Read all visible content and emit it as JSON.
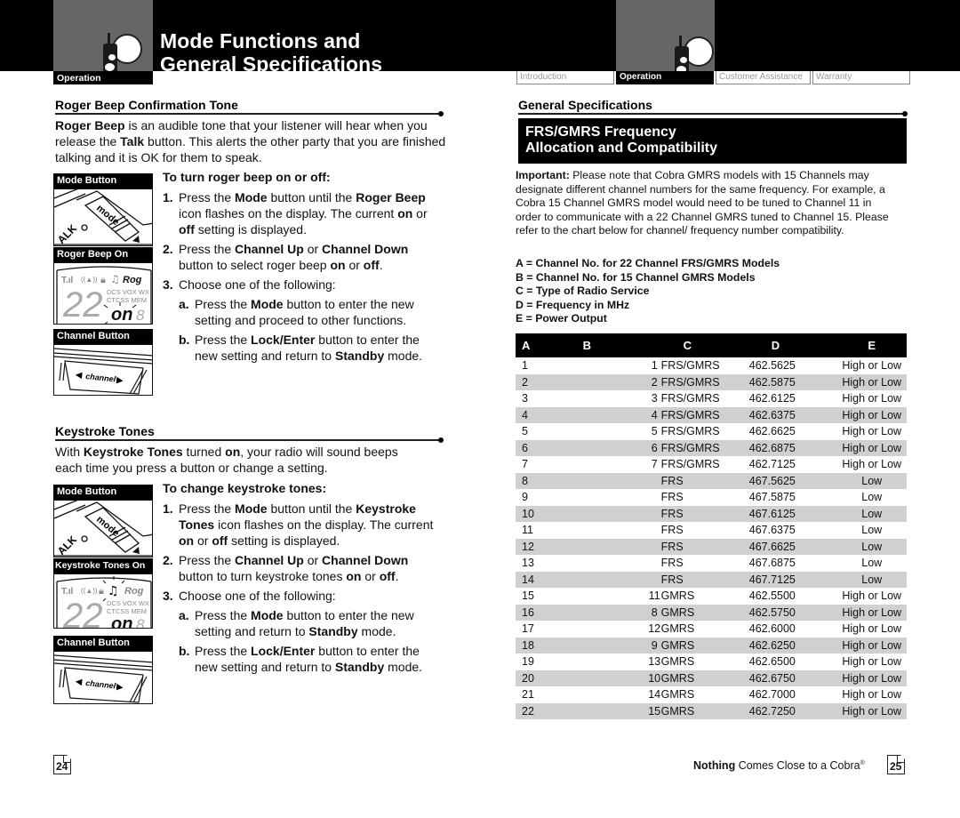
{
  "header": {
    "title_line1": "Mode Functions and",
    "title_line2": "General Specifications",
    "left_tab_label": "Operation",
    "nav_tabs": [
      {
        "label": "Introduction",
        "active": false
      },
      {
        "label": "Operation",
        "active": true
      },
      {
        "label": "Customer Assistance",
        "active": false
      },
      {
        "label": "Warranty",
        "active": false
      }
    ],
    "tab_icon": "walkie-talkie-icon"
  },
  "left_page": {
    "roger_beep": {
      "heading": "Roger Beep Confirmation Tone",
      "intro_parts": [
        {
          "text": "Roger Beep",
          "bold": true
        },
        {
          "text": " is an audible tone that your listener will hear when you release the ",
          "bold": false
        },
        {
          "text": "Talk",
          "bold": true
        },
        {
          "text": " button. This alerts the other party that you are finished talking and it is OK for them to speak.",
          "bold": false
        }
      ],
      "image_labels": [
        "Mode Button",
        "Roger Beep On",
        "Channel Button"
      ],
      "subheading": "To turn roger beep on or off:",
      "steps": [
        {
          "num": "1.",
          "parts": [
            {
              "text": "Press the ",
              "bold": false
            },
            {
              "text": "Mode",
              "bold": true
            },
            {
              "text": " button until the ",
              "bold": false
            },
            {
              "text": "Roger Beep",
              "bold": true
            },
            {
              "text": " icon flashes on the display. The current ",
              "bold": false
            },
            {
              "text": "on",
              "bold": true
            },
            {
              "text": " or ",
              "bold": false
            },
            {
              "text": "off",
              "bold": true
            },
            {
              "text": " setting is displayed.",
              "bold": false
            }
          ]
        },
        {
          "num": "2.",
          "parts": [
            {
              "text": "Press the ",
              "bold": false
            },
            {
              "text": "Channel Up",
              "bold": true
            },
            {
              "text": " or ",
              "bold": false
            },
            {
              "text": "Channel Down",
              "bold": true
            },
            {
              "text": " button to select roger beep ",
              "bold": false
            },
            {
              "text": "on",
              "bold": true
            },
            {
              "text": " or ",
              "bold": false
            },
            {
              "text": "off",
              "bold": true
            },
            {
              "text": ".",
              "bold": false
            }
          ]
        },
        {
          "num": "3.",
          "parts": [
            {
              "text": "Choose one of the following:",
              "bold": false
            }
          ]
        }
      ],
      "substeps": [
        {
          "num": "a.",
          "parts": [
            {
              "text": "Press the ",
              "bold": false
            },
            {
              "text": "Mode",
              "bold": true
            },
            {
              "text": " button to enter the new setting and proceed to other functions.",
              "bold": false
            }
          ]
        },
        {
          "num": "b.",
          "parts": [
            {
              "text": "Press the ",
              "bold": false
            },
            {
              "text": "Lock/Enter",
              "bold": true
            },
            {
              "text": " button to enter the new setting and return to ",
              "bold": false
            },
            {
              "text": "Standby",
              "bold": true
            },
            {
              "text": " mode.",
              "bold": false
            }
          ]
        }
      ]
    },
    "keystroke": {
      "heading": "Keystroke Tones",
      "intro_parts": [
        {
          "text": "With ",
          "bold": false
        },
        {
          "text": "Keystroke Tones",
          "bold": true
        },
        {
          "text": " turned ",
          "bold": false
        },
        {
          "text": "on",
          "bold": true
        },
        {
          "text": ", your radio will sound beeps each time you press a button or change a setting.",
          "bold": false
        }
      ],
      "image_labels": [
        "Mode Button",
        "Keystroke Tones On",
        "Channel Button"
      ],
      "subheading": "To change keystroke tones:",
      "steps": [
        {
          "num": "1.",
          "parts": [
            {
              "text": "Press the ",
              "bold": false
            },
            {
              "text": "Mode",
              "bold": true
            },
            {
              "text": " button until the ",
              "bold": false
            },
            {
              "text": "Keystroke Tones",
              "bold": true
            },
            {
              "text": " icon flashes on the display. The current ",
              "bold": false
            },
            {
              "text": "on",
              "bold": true
            },
            {
              "text": " or ",
              "bold": false
            },
            {
              "text": "off",
              "bold": true
            },
            {
              "text": " setting is displayed.",
              "bold": false
            }
          ]
        },
        {
          "num": "2.",
          "parts": [
            {
              "text": "Press the ",
              "bold": false
            },
            {
              "text": "Channel Up",
              "bold": true
            },
            {
              "text": " or ",
              "bold": false
            },
            {
              "text": "Channel Down",
              "bold": true
            },
            {
              "text": " button to turn keystroke tones ",
              "bold": false
            },
            {
              "text": "on",
              "bold": true
            },
            {
              "text": " or ",
              "bold": false
            },
            {
              "text": "off",
              "bold": true
            },
            {
              "text": ".",
              "bold": false
            }
          ]
        },
        {
          "num": "3.",
          "parts": [
            {
              "text": "Choose one of the following:",
              "bold": false
            }
          ]
        }
      ],
      "substeps": [
        {
          "num": "a.",
          "parts": [
            {
              "text": "Press the ",
              "bold": false
            },
            {
              "text": "Mode",
              "bold": true
            },
            {
              "text": " button to enter the new setting and return to ",
              "bold": false
            },
            {
              "text": "Standby",
              "bold": true
            },
            {
              "text": " mode.",
              "bold": false
            }
          ]
        },
        {
          "num": "b.",
          "parts": [
            {
              "text": "Press the ",
              "bold": false
            },
            {
              "text": "Lock/Enter",
              "bold": true
            },
            {
              "text": " button to enter the new setting and return to ",
              "bold": false
            },
            {
              "text": "Standby",
              "bold": true
            },
            {
              "text": " mode.",
              "bold": false
            }
          ]
        }
      ]
    },
    "lcd": {
      "channel": "22",
      "setting": "on",
      "small_digit": "8",
      "labels": [
        "DCS",
        "VOX",
        "WX",
        "CTCSS",
        "MEM"
      ],
      "rog": "Rog"
    },
    "mode_btn_text": "mode",
    "talk_text": "ALK",
    "channel_btn_text": "channel",
    "page_number": "24"
  },
  "right_page": {
    "heading": "General Specifications",
    "box_title_line1": "FRS/GMRS Frequency",
    "box_title_line2": "Allocation and Compatibility",
    "important_label": "Important:",
    "important_text": " Please note that Cobra GMRS models with 15 Channels may designate different channel numbers for the same frequency. For example, a Cobra 15 Channel GMRS model would need to be tuned to Channel 11 in order to communicate with a 22 Channel GMRS tuned to Channel 15. Please refer to the chart below for channel/ frequency number compatibility.",
    "legend": [
      "A = Channel No. for 22 Channel FRS/GMRS Models",
      "B = Channel No. for 15 Channel GMRS Models",
      "C = Type of Radio Service",
      "D = Frequency in MHz",
      "E = Power Output"
    ],
    "table": {
      "headers": [
        "A",
        "B",
        "C",
        "D",
        "E"
      ],
      "rows": [
        [
          "1",
          "1",
          "FRS/GMRS",
          "462.5625",
          "High or Low"
        ],
        [
          "2",
          "2",
          "FRS/GMRS",
          "462.5875",
          "High or Low"
        ],
        [
          "3",
          "3",
          "FRS/GMRS",
          "462.6125",
          "High or Low"
        ],
        [
          "4",
          "4",
          "FRS/GMRS",
          "462.6375",
          "High or Low"
        ],
        [
          "5",
          "5",
          "FRS/GMRS",
          "462.6625",
          "High or Low"
        ],
        [
          "6",
          "6",
          "FRS/GMRS",
          "462.6875",
          "High or Low"
        ],
        [
          "7",
          "7",
          "FRS/GMRS",
          "462.7125",
          "High or Low"
        ],
        [
          "8",
          "",
          "FRS",
          "467.5625",
          "Low"
        ],
        [
          "9",
          "",
          "FRS",
          "467.5875",
          "Low"
        ],
        [
          "10",
          "",
          "FRS",
          "467.6125",
          "Low"
        ],
        [
          "11",
          "",
          "FRS",
          "467.6375",
          "Low"
        ],
        [
          "12",
          "",
          "FRS",
          "467.6625",
          "Low"
        ],
        [
          "13",
          "",
          "FRS",
          "467.6875",
          "Low"
        ],
        [
          "14",
          "",
          "FRS",
          "467.7125",
          "Low"
        ],
        [
          "15",
          "11",
          "GMRS",
          "462.5500",
          "High or Low"
        ],
        [
          "16",
          "8",
          "GMRS",
          "462.5750",
          "High or Low"
        ],
        [
          "17",
          "12",
          "GMRS",
          "462.6000",
          "High or Low"
        ],
        [
          "18",
          "9",
          "GMRS",
          "462.6250",
          "High or Low"
        ],
        [
          "19",
          "13",
          "GMRS",
          "462.6500",
          "High or Low"
        ],
        [
          "20",
          "10",
          "GMRS",
          "462.6750",
          "High or Low"
        ],
        [
          "21",
          "14",
          "GMRS",
          "462.7000",
          "High or Low"
        ],
        [
          "22",
          "15",
          "GMRS",
          "462.7250",
          "High or Low"
        ]
      ]
    },
    "tagline_bold": "Nothing",
    "tagline_rest": " Comes Close to a Cobra",
    "tagline_mark": "®",
    "page_number": "25"
  },
  "colors": {
    "band": "#000000",
    "tab_gray": "#666666",
    "row_alt": "#d0d0d0"
  }
}
